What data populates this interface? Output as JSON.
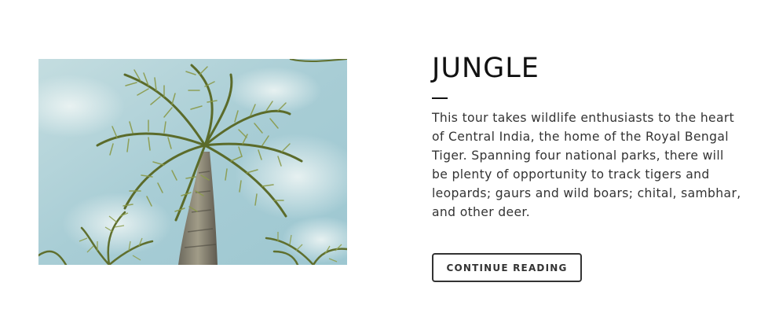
{
  "post": {
    "image_subject": "palm tree against cloudy sky",
    "title": "JUNGLE",
    "excerpt": "This tour takes wildlife enthusiasts to the heart of Central India, the home of the Royal Bengal Tiger. Spanning four national parks, there will be plenty of opportunity to track tigers and leopards; gaurs and wild boars; chital, sambhar, and other deer.",
    "button_label": "CONTINUE READING"
  },
  "colors": {
    "text": "#111111",
    "body_text": "#333333",
    "sky": "#a9cfd6",
    "frond": "#6e7f3a"
  }
}
